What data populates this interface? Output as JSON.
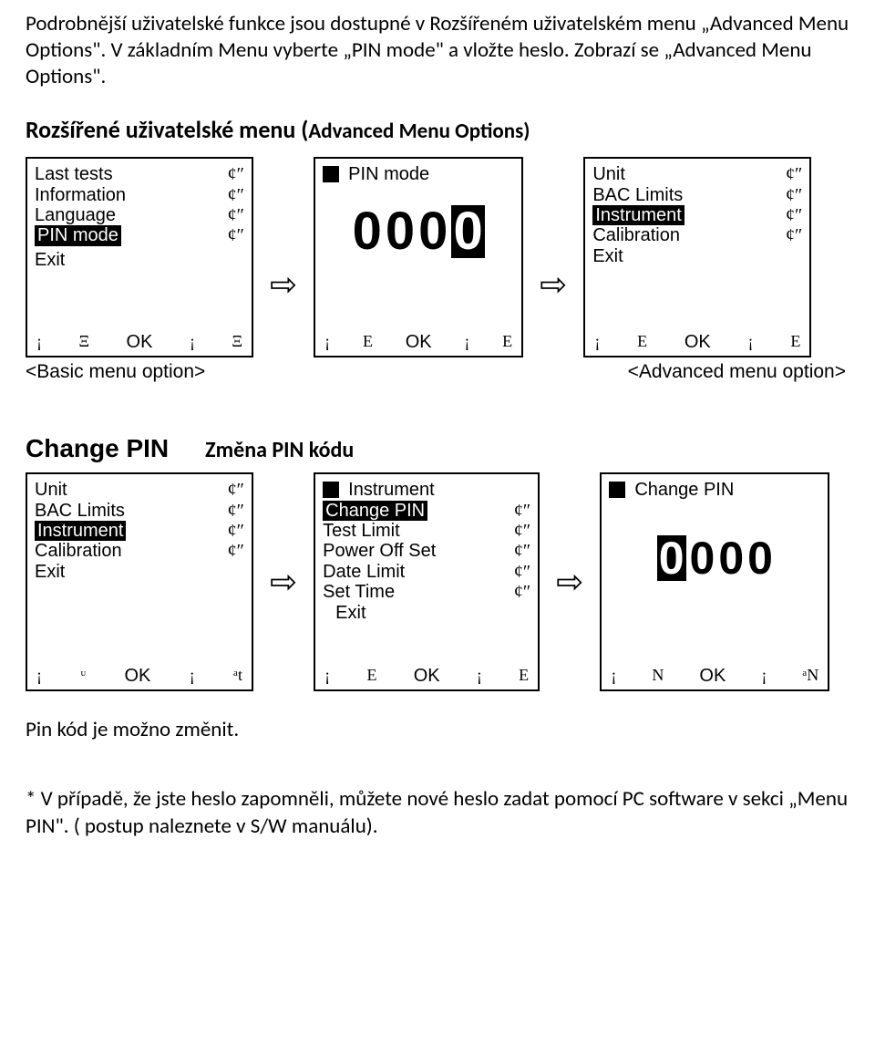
{
  "intro": "Podrobnější uživatelské funkce jsou dostupné v Rozšířeném uživatelském menu „Advanced Menu Options\". V základním Menu vyberte „PIN mode\"  a vložte heslo. Zobrazí se „Advanced Menu Options\".",
  "heading1_main": "Rozšířené uživatelské menu (",
  "heading1_sub": "Advanced Menu Options)",
  "mark": "¢″",
  "arrow_glyph": "⇨",
  "footer": {
    "l": "¡",
    "l2": "Ξ",
    "ok": "OK",
    "r": "¡",
    "r2": "Ξ",
    "E": "E",
    "at": "ᵃt",
    "ut": "ᶸ",
    "N": "N",
    "aN": "ᵃN"
  },
  "screenA": {
    "items": [
      {
        "label": "Last tests",
        "sel": false
      },
      {
        "label": "Information",
        "sel": false
      },
      {
        "label": "Language",
        "sel": false
      },
      {
        "label": "PIN mode",
        "sel": true
      }
    ],
    "exit": "Exit"
  },
  "screenB": {
    "title": "PIN mode",
    "digits": [
      "0",
      "0",
      "0",
      "0"
    ],
    "active": 3
  },
  "screenC": {
    "items": [
      {
        "label": "Unit",
        "sel": false
      },
      {
        "label": "BAC Limits",
        "sel": false
      },
      {
        "label": "Instrument",
        "sel": true
      },
      {
        "label": "Calibration",
        "sel": false
      },
      {
        "label": "Exit",
        "sel": false,
        "nomark": true
      }
    ]
  },
  "captionL": "<Basic menu option>",
  "captionR": "<Advanced menu option>",
  "section2_bold": "Change PIN",
  "section2_cz": "Změna PIN kódu",
  "screenD": {
    "items": [
      {
        "label": "Unit",
        "sel": false
      },
      {
        "label": "BAC Limits",
        "sel": false
      },
      {
        "label": "Instrument",
        "sel": true
      },
      {
        "label": "Calibration",
        "sel": false
      },
      {
        "label": "Exit",
        "sel": false,
        "nomark": true
      }
    ]
  },
  "screenE": {
    "title": "Instrument",
    "items": [
      {
        "label": "Change PIN",
        "sel": true
      },
      {
        "label": "Test Limit",
        "sel": false
      },
      {
        "label": "Power Off Set",
        "sel": false
      },
      {
        "label": "Date Limit",
        "sel": false
      },
      {
        "label": "Set Time",
        "sel": false
      }
    ],
    "exit": "Exit"
  },
  "screenF": {
    "title": "Change PIN",
    "digits": [
      "0",
      "0",
      "0",
      "0"
    ],
    "active": 0
  },
  "note1": "Pin kód je možno změnit.",
  "note2": "* V případě, že jste heslo zapomněli,  můžete nové heslo zadat pomocí PC software v sekci „Menu PIN\". ( postup naleznete v S/W manuálu)."
}
